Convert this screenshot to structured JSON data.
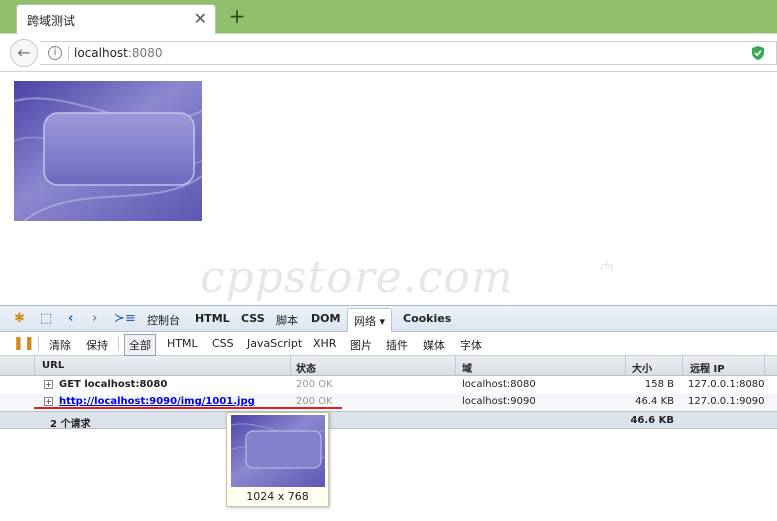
{
  "browser": {
    "tab_title": "跨域测试",
    "tab_close": "✕",
    "new_tab": "+",
    "url_host": "localhost",
    "url_port": ":8080"
  },
  "watermark": {
    "text": "cppstore.com",
    "sub": "zfq"
  },
  "firebug": {
    "panels": [
      "控制台",
      "HTML",
      "CSS",
      "脚本",
      "DOM",
      "网络 ▾",
      "Cookies"
    ],
    "active_panel": "网络 ▾",
    "actions": {
      "clear": "清除",
      "persist": "保持"
    },
    "filters": [
      "全部",
      "HTML",
      "CSS",
      "JavaScript",
      "XHR",
      "图片",
      "插件",
      "媒体",
      "字体"
    ],
    "selected_filter": "全部",
    "columns": {
      "url": "URL",
      "status": "状态",
      "domain": "域",
      "size": "大小",
      "remote_ip": "远程 IP"
    },
    "requests": [
      {
        "url": "GET localhost:8080",
        "status": "200 OK",
        "domain": "localhost:8080",
        "size": "158 B",
        "remote_ip": "127.0.0.1:8080"
      },
      {
        "url": "http://localhost:9090/img/1001.jpg",
        "status": "200 OK",
        "domain": "localhost:9090",
        "size": "46.4 KB",
        "remote_ip": "127.0.0.1:9090"
      }
    ],
    "summary": {
      "count": "2 个请求",
      "total_size": "46.6 KB"
    },
    "preview": {
      "dimensions": "1024 x 768"
    }
  },
  "colors": {
    "tab_strip": "#8fbf6a",
    "link": "#0000ee",
    "highlight": "#e02020",
    "image_purple": "#6a63b8"
  }
}
